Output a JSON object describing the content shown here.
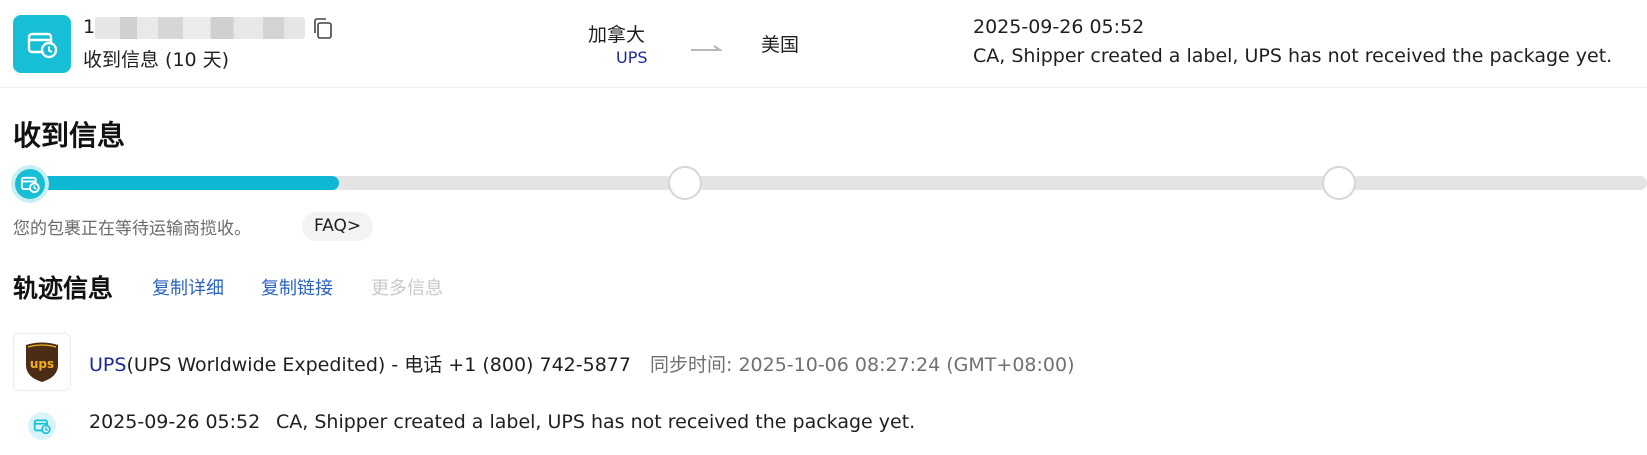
{
  "summary": {
    "tracking_number_visible": "1",
    "status": "收到信息 (10 天)",
    "origin_country": "加拿大",
    "origin_carrier": "UPS",
    "destination_country": "美国",
    "latest_event_time": "2025-09-26 05:52",
    "latest_event_desc": "CA, Shipper created a label, UPS has not received the package yet.",
    "status_icon": "package-clock-icon",
    "copy_icon": "copy-icon",
    "arrow_icon": "arrow-right-icon"
  },
  "progress": {
    "title": "收到信息",
    "current_step": 1,
    "step_count": 3,
    "fill_fraction": 0.195,
    "hint": "您的包裹正在等待运输商揽收。",
    "faq_label": "FAQ>"
  },
  "tracking": {
    "title": "轨迹信息",
    "copy_details": "复制详细",
    "copy_link": "复制链接",
    "more_info": "更多信息",
    "carrier_name": "UPS",
    "carrier_service": "(UPS Worldwide Expedited)",
    "carrier_phone": " - 电话 +1 (800) 742-5877",
    "sync_time": "同步时间: 2025-10-06 08:27:24 (GMT+08:00)",
    "logo_text": "ups",
    "events": [
      {
        "time": "2025-09-26 05:52",
        "desc": "CA, Shipper created a label, UPS has not received the package yet."
      }
    ]
  },
  "colors": {
    "accent": "#16bfd6",
    "carrier_link": "#1a2a9c",
    "action_link": "#2a63c6",
    "ups_brown": "#4b2c14",
    "ups_gold": "#f5b21b"
  }
}
